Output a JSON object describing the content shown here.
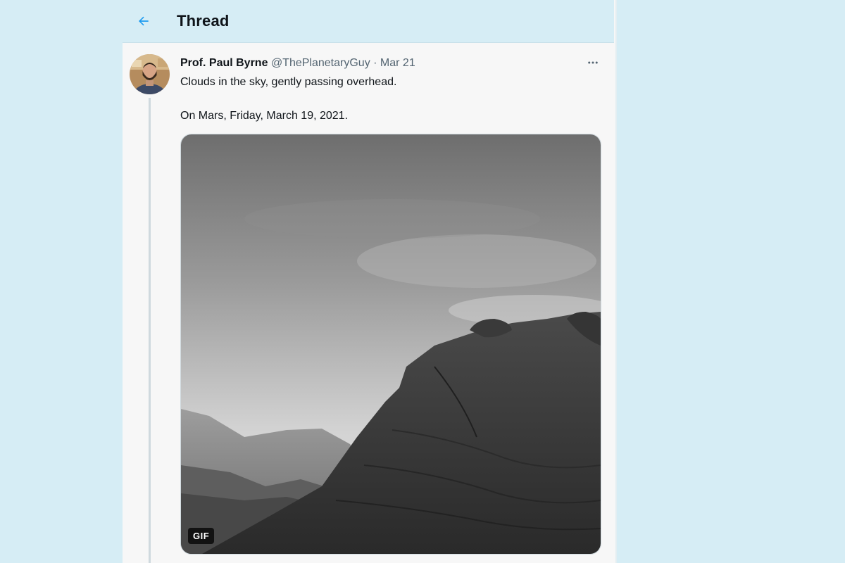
{
  "header": {
    "title": "Thread",
    "back_icon": "arrow-left-icon",
    "accent_color": "#1d9bf0"
  },
  "tweet": {
    "display_name": "Prof. Paul Byrne",
    "handle": "@ThePlanetaryGuy",
    "separator": "·",
    "date": "Mar 21",
    "more_icon": "more-horizontal-icon",
    "text_line_1": "Clouds in the sky, gently passing overhead.",
    "text_line_2": "On Mars, Friday, March 19, 2021.",
    "media": {
      "badge": "GIF",
      "description_icon": "mars-landscape-image"
    }
  }
}
